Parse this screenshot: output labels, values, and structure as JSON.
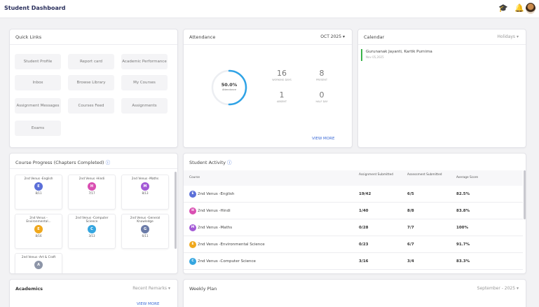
{
  "app": {
    "title": "Student Dashboard"
  },
  "header_icons": [
    "graduation-cap-icon",
    "bell-icon",
    "user-avatar"
  ],
  "quick_links": {
    "title": "Quick Links",
    "items": [
      "Student Profile",
      "Report card",
      "Academic Performance",
      "Inbox",
      "Browse Library",
      "My Courses",
      "Assignment Messages",
      "Courses Feed",
      "Assignments",
      "Exams"
    ]
  },
  "attendance": {
    "title": "Attendance",
    "month": "OCT 2025",
    "percent": "50.0%",
    "percent_label": "Attendance",
    "percent_value": 0.5,
    "working_days": {
      "value": "16",
      "label": "WORKING DAYS"
    },
    "present": {
      "value": "8",
      "label": "PRESENT"
    },
    "absent": {
      "value": "1",
      "label": "ABSENT"
    },
    "half_day": {
      "value": "0",
      "label": "HALF DAY"
    },
    "view_more": "VIEW MORE"
  },
  "calendar": {
    "title": "Calendar",
    "filter": "Holidays",
    "event": {
      "name": "Gurunanak Jayanti, Kartik Purnima",
      "date": "Nov 05,2025"
    }
  },
  "course_progress": {
    "title": "Course Progress (Chapters Completed)",
    "items": [
      {
        "name": "2nd Venus -English",
        "count": "8/11",
        "initial": "E",
        "color": "#5b6fd8"
      },
      {
        "name": "2nd Venus -Hindi",
        "count": "7/17",
        "initial": "H",
        "color": "#d94fb2"
      },
      {
        "name": "2nd Venus -Maths",
        "count": "8/13",
        "initial": "M",
        "color": "#a35ad6"
      },
      {
        "name": "2nd Venus - Environmental...",
        "count": "8/16",
        "initial": "E",
        "color": "#f0a81c"
      },
      {
        "name": "2nd Venus -Computer Science",
        "count": "3/13",
        "initial": "C",
        "color": "#35a6e0"
      },
      {
        "name": "2nd Venus -General Knowledge",
        "count": "6/11",
        "initial": "G",
        "color": "#6b7ba8"
      },
      {
        "name": "2nd Venus -Art & Craft",
        "count": "",
        "initial": "A",
        "color": "#8d95a8"
      }
    ]
  },
  "student_activity": {
    "title": "Student Activity",
    "headers": [
      "Course",
      "Assignment Submitted",
      "Assessment Submitted",
      "Average Score"
    ],
    "rows": [
      {
        "course": "2nd Venus -English",
        "assignment": "19/42",
        "assessment": "6/5",
        "score": "82.5%",
        "initial": "E",
        "color": "#5b6fd8"
      },
      {
        "course": "2nd Venus -Hindi",
        "assignment": "1/40",
        "assessment": "8/8",
        "score": "83.8%",
        "initial": "H",
        "color": "#d94fb2"
      },
      {
        "course": "2nd Venus -Maths",
        "assignment": "0/28",
        "assessment": "7/7",
        "score": "100%",
        "initial": "M",
        "color": "#a35ad6"
      },
      {
        "course": "2nd Venus -Environmental Science",
        "assignment": "0/23",
        "assessment": "6/7",
        "score": "91.7%",
        "initial": "E",
        "color": "#f0a81c"
      },
      {
        "course": "2nd Venus -Computer Science",
        "assignment": "3/16",
        "assessment": "3/4",
        "score": "83.3%",
        "initial": "C",
        "color": "#35a6e0"
      }
    ]
  },
  "academics": {
    "title": "Academics",
    "filter": "Recent Remarks",
    "view_more": "VIEW MORE"
  },
  "weekly_plan": {
    "title": "Weekly Plan",
    "filter": "September - 2025"
  }
}
